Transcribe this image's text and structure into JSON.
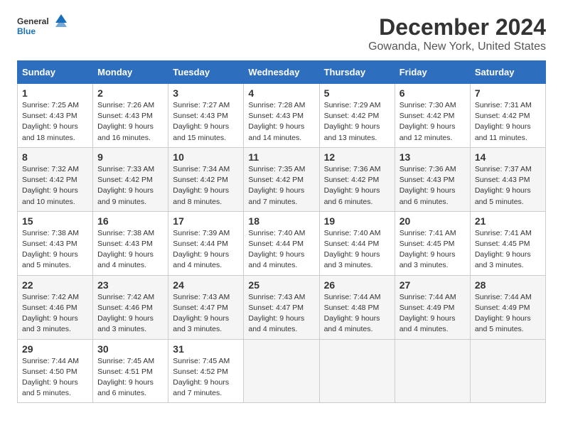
{
  "header": {
    "logo_general": "General",
    "logo_blue": "Blue",
    "title": "December 2024",
    "subtitle": "Gowanda, New York, United States"
  },
  "columns": [
    "Sunday",
    "Monday",
    "Tuesday",
    "Wednesday",
    "Thursday",
    "Friday",
    "Saturday"
  ],
  "weeks": [
    [
      {
        "day": "1",
        "info": "Sunrise: 7:25 AM\nSunset: 4:43 PM\nDaylight: 9 hours and 18 minutes."
      },
      {
        "day": "2",
        "info": "Sunrise: 7:26 AM\nSunset: 4:43 PM\nDaylight: 9 hours and 16 minutes."
      },
      {
        "day": "3",
        "info": "Sunrise: 7:27 AM\nSunset: 4:43 PM\nDaylight: 9 hours and 15 minutes."
      },
      {
        "day": "4",
        "info": "Sunrise: 7:28 AM\nSunset: 4:43 PM\nDaylight: 9 hours and 14 minutes."
      },
      {
        "day": "5",
        "info": "Sunrise: 7:29 AM\nSunset: 4:42 PM\nDaylight: 9 hours and 13 minutes."
      },
      {
        "day": "6",
        "info": "Sunrise: 7:30 AM\nSunset: 4:42 PM\nDaylight: 9 hours and 12 minutes."
      },
      {
        "day": "7",
        "info": "Sunrise: 7:31 AM\nSunset: 4:42 PM\nDaylight: 9 hours and 11 minutes."
      }
    ],
    [
      {
        "day": "8",
        "info": "Sunrise: 7:32 AM\nSunset: 4:42 PM\nDaylight: 9 hours and 10 minutes."
      },
      {
        "day": "9",
        "info": "Sunrise: 7:33 AM\nSunset: 4:42 PM\nDaylight: 9 hours and 9 minutes."
      },
      {
        "day": "10",
        "info": "Sunrise: 7:34 AM\nSunset: 4:42 PM\nDaylight: 9 hours and 8 minutes."
      },
      {
        "day": "11",
        "info": "Sunrise: 7:35 AM\nSunset: 4:42 PM\nDaylight: 9 hours and 7 minutes."
      },
      {
        "day": "12",
        "info": "Sunrise: 7:36 AM\nSunset: 4:42 PM\nDaylight: 9 hours and 6 minutes."
      },
      {
        "day": "13",
        "info": "Sunrise: 7:36 AM\nSunset: 4:43 PM\nDaylight: 9 hours and 6 minutes."
      },
      {
        "day": "14",
        "info": "Sunrise: 7:37 AM\nSunset: 4:43 PM\nDaylight: 9 hours and 5 minutes."
      }
    ],
    [
      {
        "day": "15",
        "info": "Sunrise: 7:38 AM\nSunset: 4:43 PM\nDaylight: 9 hours and 5 minutes."
      },
      {
        "day": "16",
        "info": "Sunrise: 7:38 AM\nSunset: 4:43 PM\nDaylight: 9 hours and 4 minutes."
      },
      {
        "day": "17",
        "info": "Sunrise: 7:39 AM\nSunset: 4:44 PM\nDaylight: 9 hours and 4 minutes."
      },
      {
        "day": "18",
        "info": "Sunrise: 7:40 AM\nSunset: 4:44 PM\nDaylight: 9 hours and 4 minutes."
      },
      {
        "day": "19",
        "info": "Sunrise: 7:40 AM\nSunset: 4:44 PM\nDaylight: 9 hours and 3 minutes."
      },
      {
        "day": "20",
        "info": "Sunrise: 7:41 AM\nSunset: 4:45 PM\nDaylight: 9 hours and 3 minutes."
      },
      {
        "day": "21",
        "info": "Sunrise: 7:41 AM\nSunset: 4:45 PM\nDaylight: 9 hours and 3 minutes."
      }
    ],
    [
      {
        "day": "22",
        "info": "Sunrise: 7:42 AM\nSunset: 4:46 PM\nDaylight: 9 hours and 3 minutes."
      },
      {
        "day": "23",
        "info": "Sunrise: 7:42 AM\nSunset: 4:46 PM\nDaylight: 9 hours and 3 minutes."
      },
      {
        "day": "24",
        "info": "Sunrise: 7:43 AM\nSunset: 4:47 PM\nDaylight: 9 hours and 3 minutes."
      },
      {
        "day": "25",
        "info": "Sunrise: 7:43 AM\nSunset: 4:47 PM\nDaylight: 9 hours and 4 minutes."
      },
      {
        "day": "26",
        "info": "Sunrise: 7:44 AM\nSunset: 4:48 PM\nDaylight: 9 hours and 4 minutes."
      },
      {
        "day": "27",
        "info": "Sunrise: 7:44 AM\nSunset: 4:49 PM\nDaylight: 9 hours and 4 minutes."
      },
      {
        "day": "28",
        "info": "Sunrise: 7:44 AM\nSunset: 4:49 PM\nDaylight: 9 hours and 5 minutes."
      }
    ],
    [
      {
        "day": "29",
        "info": "Sunrise: 7:44 AM\nSunset: 4:50 PM\nDaylight: 9 hours and 5 minutes."
      },
      {
        "day": "30",
        "info": "Sunrise: 7:45 AM\nSunset: 4:51 PM\nDaylight: 9 hours and 6 minutes."
      },
      {
        "day": "31",
        "info": "Sunrise: 7:45 AM\nSunset: 4:52 PM\nDaylight: 9 hours and 7 minutes."
      },
      null,
      null,
      null,
      null
    ]
  ]
}
